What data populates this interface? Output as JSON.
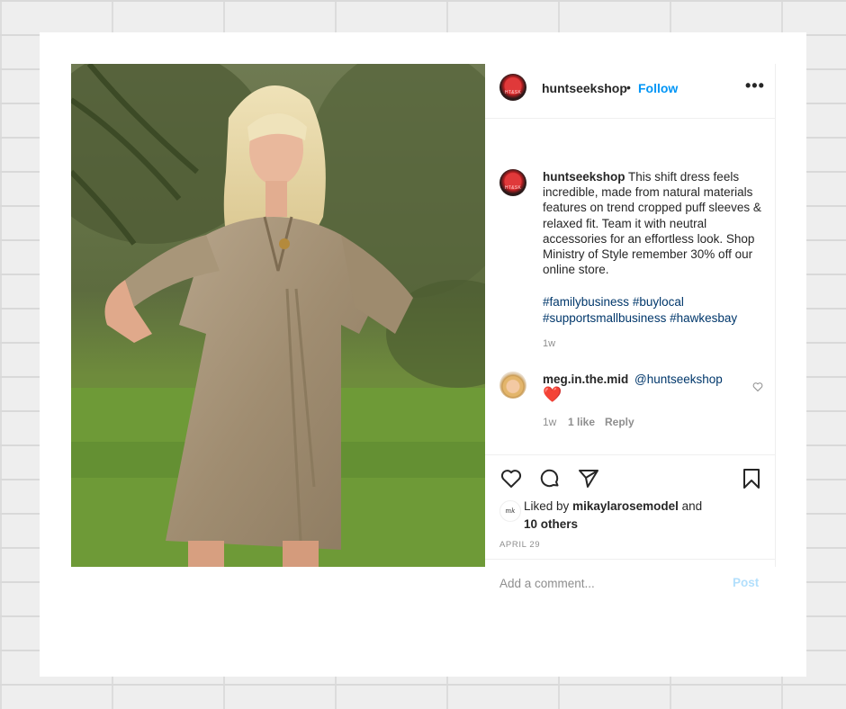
{
  "post": {
    "username": "huntseekshop",
    "separator": "•",
    "follow_label": "Follow",
    "more_label": "•••",
    "avatar_text": "HT&SK",
    "caption_text": "This shift dress feels incredible, made from natural materials features on trend cropped puff sleeves & relaxed fit. Team it with neutral accessories for an effortless look. Shop Ministry of Style remember 30% off our online store.",
    "hashtags": [
      "#familybusiness",
      "#buylocal",
      "#supportsmallbusiness",
      "#hawkesbay"
    ],
    "time": "1w"
  },
  "comment": {
    "username": "meg.in.the.mid",
    "mention": "@huntseekshop",
    "emoji": "❤️",
    "time": "1w",
    "likes": "1 like",
    "reply_label": "Reply"
  },
  "likes": {
    "prefix": "Liked by",
    "user": "mikaylarosemodel",
    "joiner": "and",
    "others": "10 others",
    "avatar_text": "mk"
  },
  "date": "APRIL 29",
  "add_comment": {
    "placeholder": "Add a comment...",
    "post_label": "Post"
  },
  "icons": [
    "more-icon",
    "heart-icon",
    "comment-icon",
    "share-icon",
    "bookmark-icon",
    "comment-like-icon"
  ],
  "colors": {
    "link_blue": "#0095f6",
    "hashtag_blue": "#00376b",
    "muted": "#8e8e8e",
    "text": "#262626",
    "post_disabled": "#b2dffc"
  }
}
